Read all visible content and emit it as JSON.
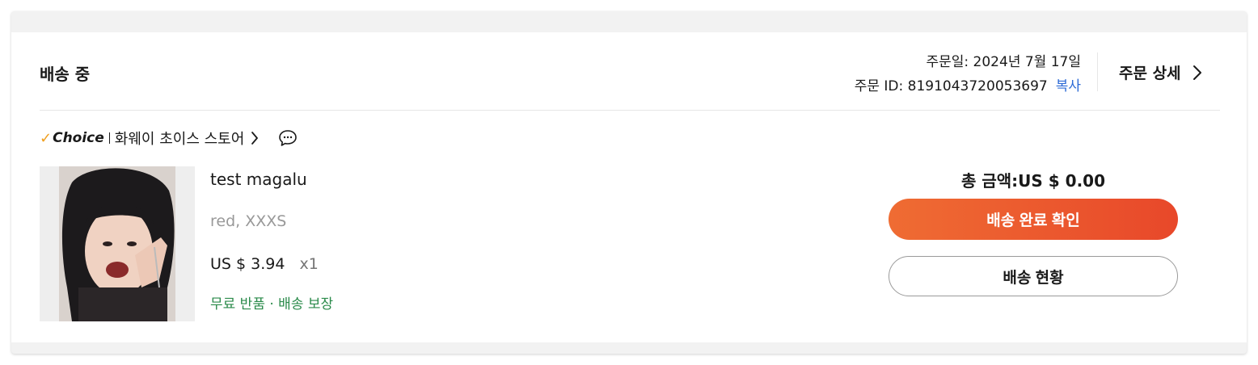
{
  "order": {
    "status": "배송 중",
    "date_label": "주문일: 2024년 7월 17일",
    "id_label": "주문 ID: 8191043720053697",
    "copy_label": "복사",
    "detail_label": "주문 상세"
  },
  "store": {
    "badge_label": "Choice",
    "name": "화웨이 초이스 스토어",
    "badge_color": "#f0a020"
  },
  "item": {
    "title": "test magalu",
    "sku": "red, XXXS",
    "price": "US $ 3.94",
    "quantity": "x1",
    "guarantee": "무료 반품 · 배송 보장"
  },
  "summary": {
    "total_label": "총 금액:US $ 0.00",
    "confirm_button": "배송 완료 확인",
    "tracking_button": "배송 현황",
    "accent_color": "#e8482a"
  },
  "icons": {
    "detail": "chevron-right-icon",
    "store": "chevron-right-icon",
    "chat": "chat-bubble-icon",
    "choice": "checkmark-icon"
  }
}
